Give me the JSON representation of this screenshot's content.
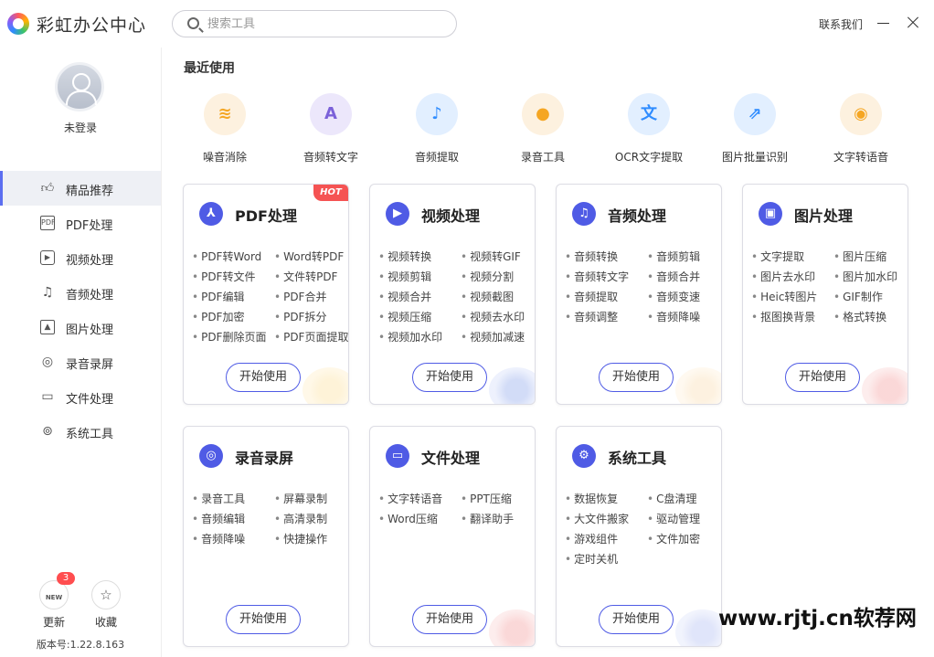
{
  "app": {
    "title": "彩虹办公中心"
  },
  "search": {
    "placeholder": "搜索工具"
  },
  "header": {
    "contact": "联系我们"
  },
  "user": {
    "status": "未登录"
  },
  "sidebar": {
    "items": [
      {
        "label": "精品推荐",
        "icon": "thumbs-up-icon",
        "active": true
      },
      {
        "label": "PDF处理",
        "icon": "pdf-icon"
      },
      {
        "label": "视频处理",
        "icon": "video-icon"
      },
      {
        "label": "音频处理",
        "icon": "music-note-icon"
      },
      {
        "label": "图片处理",
        "icon": "image-icon"
      },
      {
        "label": "录音录屏",
        "icon": "microphone-icon"
      },
      {
        "label": "文件处理",
        "icon": "folder-icon"
      },
      {
        "label": "系统工具",
        "icon": "system-icon"
      }
    ],
    "update": {
      "label": "更新",
      "badge": "3",
      "icon_text": "NEW"
    },
    "favorite": {
      "label": "收藏"
    },
    "version": "版本号:1.22.8.163"
  },
  "recent": {
    "title": "最近使用",
    "items": [
      {
        "label": "噪音消除",
        "icon": "noise-cancel-icon",
        "color": "#f5a623",
        "bg": "#fdf1df"
      },
      {
        "label": "音频转文字",
        "icon": "audio-to-text-icon",
        "color": "#7b61d9",
        "bg": "#ece7fb"
      },
      {
        "label": "音频提取",
        "icon": "audio-extract-icon",
        "color": "#2f8cff",
        "bg": "#e2efff"
      },
      {
        "label": "录音工具",
        "icon": "recorder-icon",
        "color": "#f5a623",
        "bg": "#fdf1df"
      },
      {
        "label": "OCR文字提取",
        "icon": "ocr-icon",
        "color": "#2f8cff",
        "bg": "#e2efff"
      },
      {
        "label": "图片批量识别",
        "icon": "image-recognize-icon",
        "color": "#2f8cff",
        "bg": "#e2efff"
      },
      {
        "label": "文字转语音",
        "icon": "text-to-speech-icon",
        "color": "#f5a623",
        "bg": "#fdf1df"
      }
    ]
  },
  "cards": [
    {
      "title": "PDF处理",
      "hot": "HOT",
      "items": [
        "PDF转Word",
        "Word转PDF",
        "PDF转文件",
        "文件转PDF",
        "PDF编辑",
        "PDF合并",
        "PDF加密",
        "PDF拆分",
        "PDF删除页面",
        "PDF页面提取"
      ],
      "button": "开始使用"
    },
    {
      "title": "视频处理",
      "items": [
        "视频转换",
        "视频转GIF",
        "视频剪辑",
        "视频分割",
        "视频合并",
        "视频截图",
        "视频压缩",
        "视频去水印",
        "视频加水印",
        "视频加减速"
      ],
      "button": "开始使用"
    },
    {
      "title": "音频处理",
      "items": [
        "音频转换",
        "音频剪辑",
        "音频转文字",
        "音频合并",
        "音频提取",
        "音频变速",
        "音频调整",
        "音频降噪"
      ],
      "button": "开始使用"
    },
    {
      "title": "图片处理",
      "items": [
        "文字提取",
        "图片压缩",
        "图片去水印",
        "图片加水印",
        "Heic转图片",
        "GIF制作",
        "抠图换背景",
        "格式转换"
      ],
      "button": "开始使用"
    },
    {
      "title": "录音录屏",
      "items": [
        "录音工具",
        "屏幕录制",
        "音频编辑",
        "高清录制",
        "音频降噪",
        "快捷操作"
      ],
      "button": "开始使用"
    },
    {
      "title": "文件处理",
      "items": [
        "文字转语音",
        "PPT压缩",
        "Word压缩",
        "翻译助手"
      ],
      "button": "开始使用"
    },
    {
      "title": "系统工具",
      "items": [
        "数据恢复",
        "C盘清理",
        "大文件搬家",
        "驱动管理",
        "游戏组件",
        "文件加密",
        "定时关机"
      ],
      "button": "开始使用"
    }
  ],
  "watermark": "www.rjtj.cn软荐网"
}
